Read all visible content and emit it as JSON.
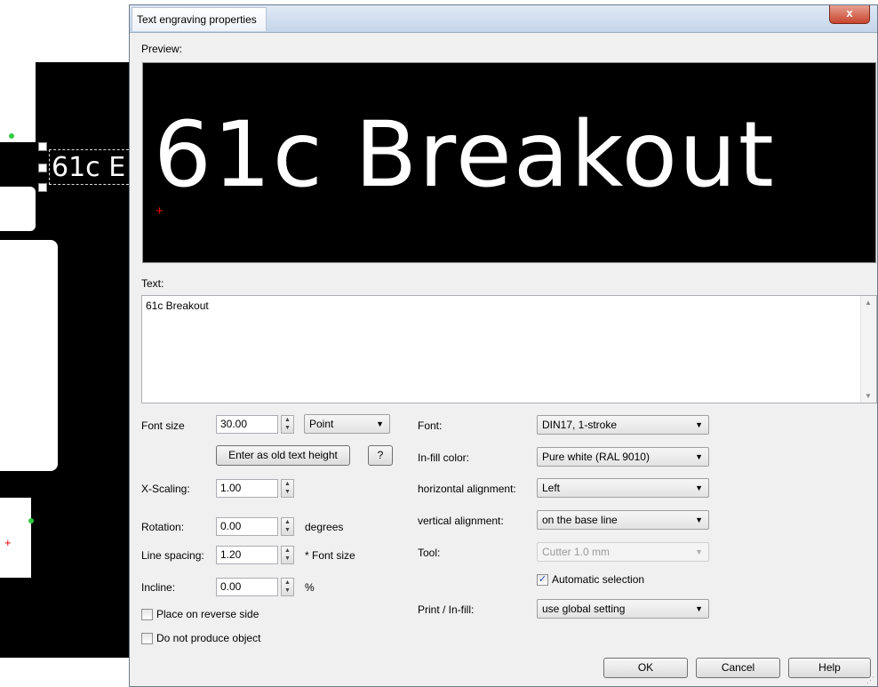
{
  "canvas": {
    "text": "61c E"
  },
  "dialog": {
    "title": "Text engraving properties",
    "close_label": "x",
    "preview_label": "Preview:",
    "preview_text": "61c Breakout",
    "text_label": "Text:",
    "text_value": "61c Breakout"
  },
  "left_column": {
    "font_size_label": "Font size",
    "font_size_value": "30.00",
    "unit_select": "Point",
    "enter_old_height_button": "Enter as old text height",
    "help_small_button": "?",
    "x_scaling_label": "X-Scaling:",
    "x_scaling_value": "1.00",
    "rotation_label": "Rotation:",
    "rotation_value": "0.00",
    "rotation_unit": "degrees",
    "line_spacing_label": "Line spacing:",
    "line_spacing_value": "1.20",
    "line_spacing_unit": "* Font size",
    "incline_label": "Incline:",
    "incline_value": "0.00",
    "incline_unit": "%",
    "place_reverse_label": "Place on reverse side",
    "place_reverse_checked": false,
    "no_produce_label": "Do not produce object",
    "no_produce_checked": false
  },
  "right_column": {
    "font_label": "Font:",
    "font_value": "DIN17, 1-stroke",
    "infill_color_label": "In-fill color:",
    "infill_color_value": "Pure white (RAL 9010)",
    "h_align_label": "horizontal alignment:",
    "h_align_value": "Left",
    "v_align_label": "vertical alignment:",
    "v_align_value": "on the base line",
    "tool_label": "Tool:",
    "tool_value": "Cutter 1.0 mm",
    "auto_select_label": "Automatic selection",
    "auto_select_checked": true,
    "print_infill_label": "Print / In-fill:",
    "print_infill_value": "use global setting"
  },
  "buttons": {
    "ok": "OK",
    "cancel": "Cancel",
    "help": "Help"
  },
  "icons": {
    "spin": "spin-up-down-icon",
    "dropdown": "chevron-down-icon",
    "checkmark": "checkmark-icon",
    "close": "close-icon"
  }
}
